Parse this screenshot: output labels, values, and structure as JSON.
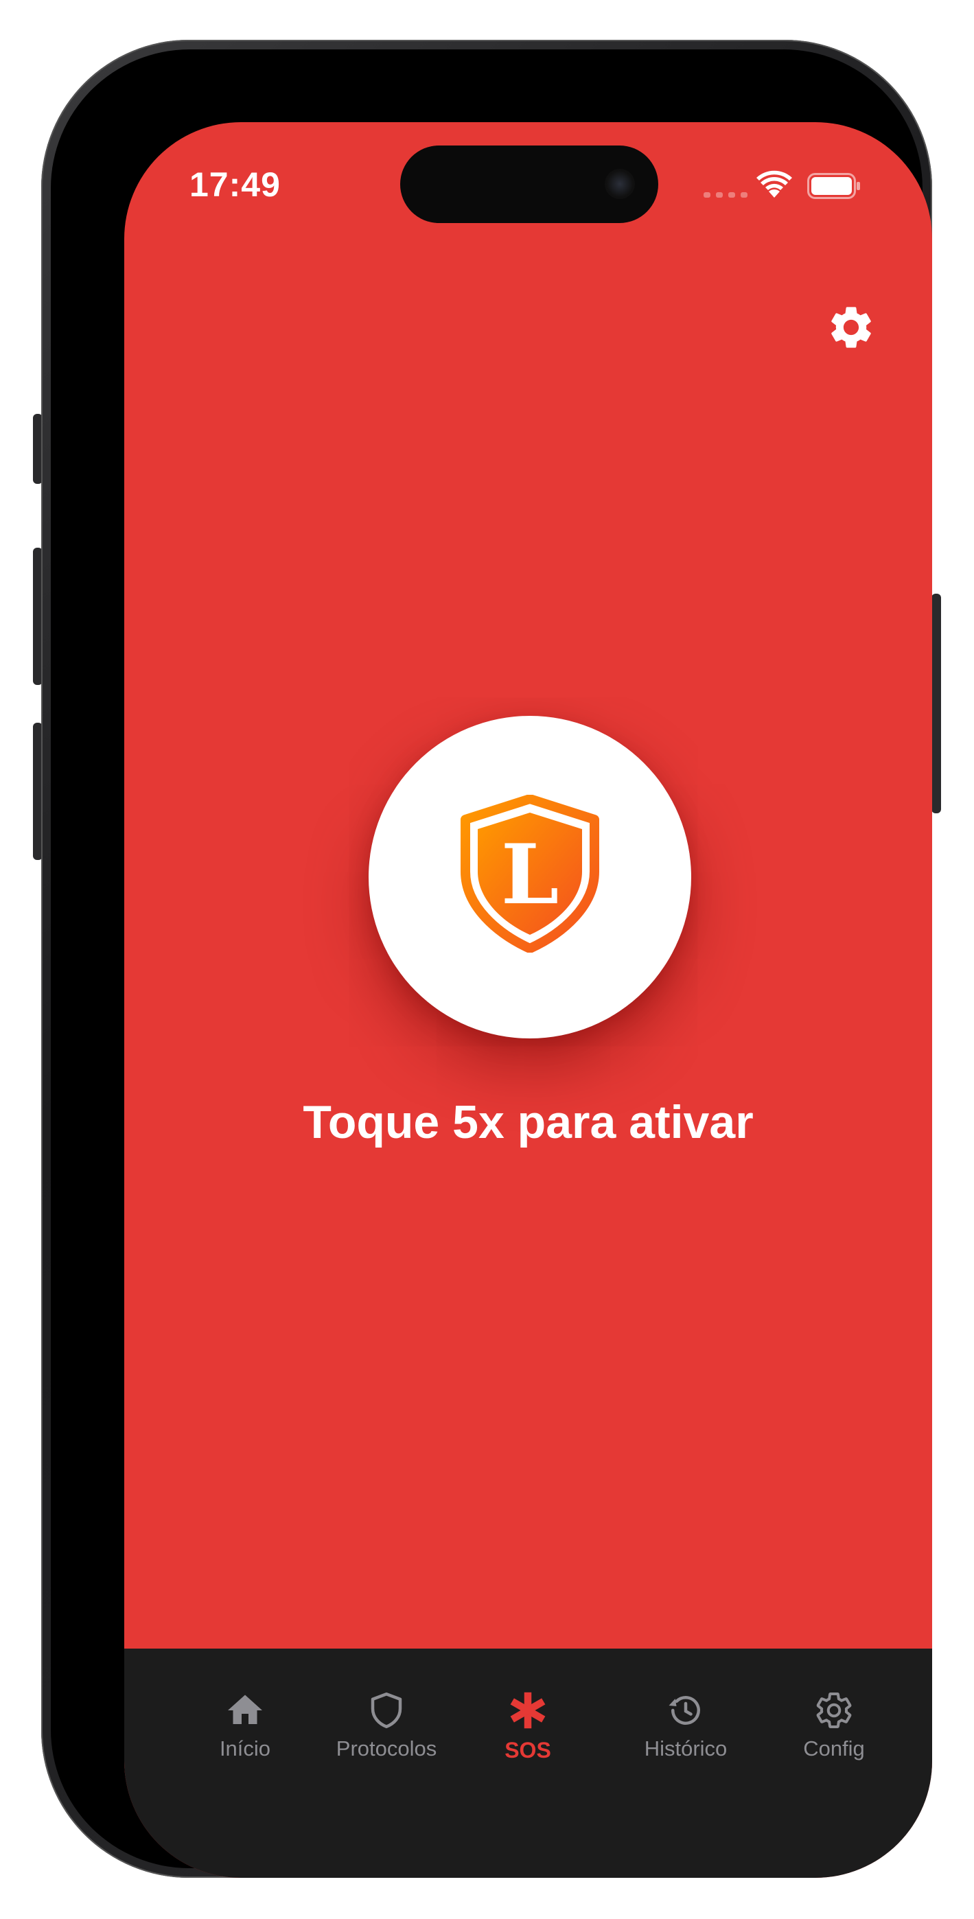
{
  "status_bar": {
    "time": "17:49"
  },
  "header": {
    "settings_icon": "gear-icon"
  },
  "sos_button": {
    "logo_icon": "shield-logo-icon",
    "logo_letter": "L",
    "instruction": "Toque 5x para ativar"
  },
  "tabbar": {
    "items": [
      {
        "label": "Início",
        "icon": "home-icon",
        "active": false
      },
      {
        "label": "Protocolos",
        "icon": "shield-icon",
        "active": false
      },
      {
        "label": "SOS",
        "icon": "asterisk-icon",
        "active": true
      },
      {
        "label": "Histórico",
        "icon": "history-icon",
        "active": false
      },
      {
        "label": "Config",
        "icon": "gear-icon",
        "active": false
      }
    ]
  },
  "colors": {
    "screen_background": "#e53935",
    "tabbar_background": "#1c1c1c",
    "active_tab": "#e53935",
    "inactive_tab": "#8e8e93",
    "logo_gradient_start": "#ff8a00",
    "logo_gradient_end": "#f4511e"
  }
}
